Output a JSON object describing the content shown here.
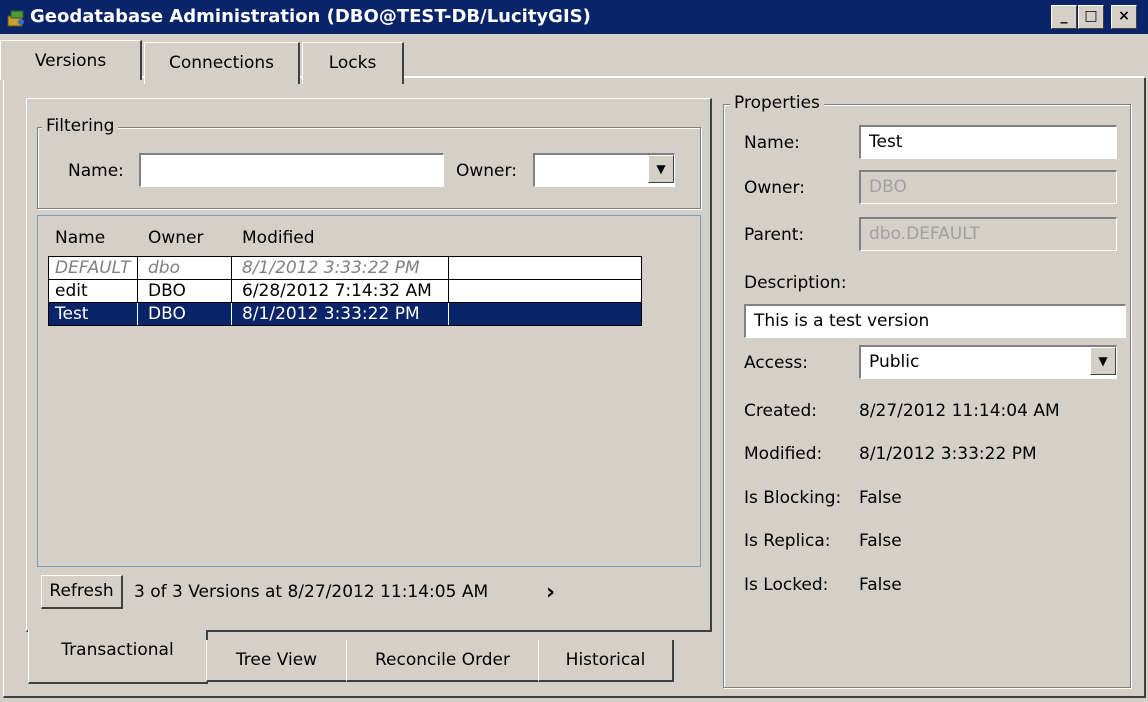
{
  "window": {
    "title": "Geodatabase Administration (DBO@TEST-DB/LucityGIS)",
    "minimize_glyph": "_",
    "maximize_glyph": "□",
    "close_glyph": "×"
  },
  "top_tabs": [
    {
      "label": "Versions",
      "active": true
    },
    {
      "label": "Connections",
      "active": false
    },
    {
      "label": "Locks",
      "active": false
    }
  ],
  "filtering": {
    "legend": "Filtering",
    "name_label": "Name:",
    "name_value": "",
    "owner_label": "Owner:",
    "owner_value": ""
  },
  "versions_list": {
    "columns": [
      "Name",
      "Owner",
      "Modified"
    ],
    "rows": [
      {
        "name": "DEFAULT",
        "owner": "dbo",
        "modified": "8/1/2012 3:33:22 PM",
        "style": "default"
      },
      {
        "name": "edit",
        "owner": "DBO",
        "modified": "6/28/2012 7:14:32 AM",
        "style": "normal"
      },
      {
        "name": "Test",
        "owner": "DBO",
        "modified": "8/1/2012 3:33:22 PM",
        "style": "selected"
      }
    ]
  },
  "status": {
    "refresh_label": "Refresh",
    "summary": "3 of 3 Versions at 8/27/2012 11:14:05 AM",
    "more_glyph": "›"
  },
  "bottom_tabs": [
    {
      "label": "Transactional",
      "active": true
    },
    {
      "label": "Tree View",
      "active": false
    },
    {
      "label": "Reconcile Order",
      "active": false
    },
    {
      "label": "Historical",
      "active": false
    }
  ],
  "properties": {
    "legend": "Properties",
    "name_label": "Name:",
    "name_value": "Test",
    "owner_label": "Owner:",
    "owner_value": "DBO",
    "parent_label": "Parent:",
    "parent_value": "dbo.DEFAULT",
    "description_label": "Description:",
    "description_value": "This is a test version",
    "access_label": "Access:",
    "access_value": "Public",
    "created_label": "Created:",
    "created_value": "8/27/2012 11:14:04 AM",
    "modified_label": "Modified:",
    "modified_value": "8/1/2012 3:33:22 PM",
    "blocking_label": "Is Blocking:",
    "blocking_value": "False",
    "replica_label": "Is Replica:",
    "replica_value": "False",
    "locked_label": "Is Locked:",
    "locked_value": "False"
  },
  "colors": {
    "titlebar": "#0a246a",
    "selection": "#0a246a",
    "face": "#d4d0c8"
  }
}
